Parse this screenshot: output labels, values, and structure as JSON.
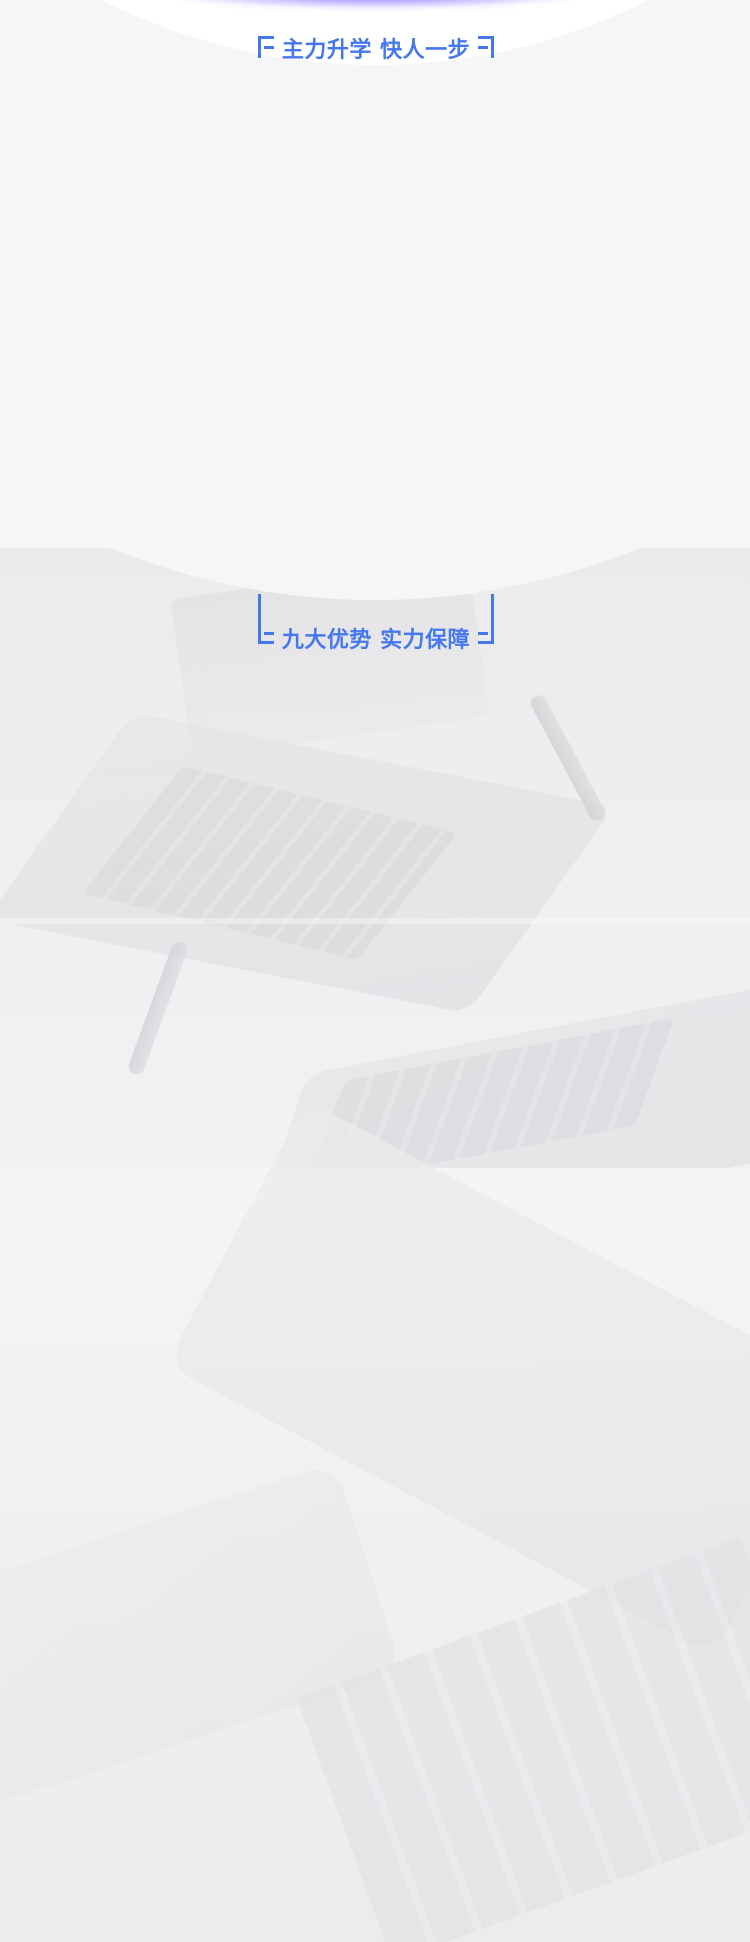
{
  "sections": [
    {
      "id": "advance",
      "title": "主力升学 快人一步"
    },
    {
      "id": "advantages",
      "title": "九大优势 实力保障"
    }
  ],
  "colors": {
    "accent": "#4577ee",
    "background": "#f6f6f8",
    "glow": "#6e5aff"
  }
}
